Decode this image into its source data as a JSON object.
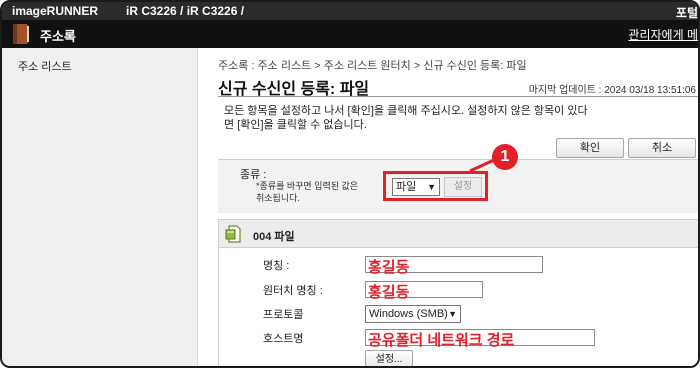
{
  "topbar": {
    "brand": "imageRUNNER",
    "model": "iR C3226 / iR C3226 /",
    "right_text": "포털"
  },
  "appbar": {
    "title": "주소록",
    "admin_link": "관리자에게 메"
  },
  "sidebar": {
    "items": [
      {
        "label": "주소 리스트"
      }
    ]
  },
  "main": {
    "breadcrumb": "주소록 : 주소 리스트 > 주소 리스트 원터치 > 신규 수신인 등록: 파일",
    "title": "신규 수신인 등록: 파일",
    "last_updated": "마지막 업데이트 : 2024 03/18 13:51:06",
    "instructions": "모든 항목을 설정하고 나서 [확인]을 클릭해 주십시오. 설정하지 않은 항목이 있다면 [확인]을 클릭할 수 없습니다.",
    "ok_label": "확인",
    "cancel_label": "취소"
  },
  "type_panel": {
    "label": "종류 :",
    "note": "*종류를 바꾸면 입력된 값은 취소됩니다.",
    "select_value": "파일",
    "set_label": "설정",
    "callout_number": "1"
  },
  "section": {
    "title": "004 파일",
    "fields": {
      "name_label": "명칭 :",
      "name_value": "홍길동",
      "onetouch_label": "원터치 명칭 :",
      "onetouch_value": "홍길동",
      "protocol_label": "프로토콜",
      "protocol_value": "Windows (SMB)",
      "host_label": "호스트명",
      "host_value": "공유폴더 네트워크 경로",
      "host_set_label": "설정..."
    }
  },
  "colors": {
    "accent_red": "#e0202a",
    "appbar_bg": "#111111",
    "sidebar_bg": "#f0f0f0"
  }
}
